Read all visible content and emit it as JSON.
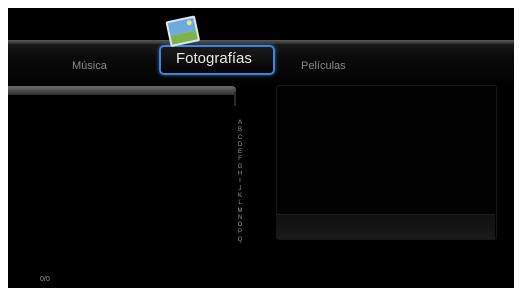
{
  "menu": {
    "items": [
      {
        "label": "Música"
      },
      {
        "label": "Fotografías"
      },
      {
        "label": "Películas"
      }
    ],
    "selected_index": 1,
    "selected_icon": "photo-icon"
  },
  "browser": {
    "counter": "0/0",
    "alphabet": [
      "A",
      "B",
      "C",
      "D",
      "E",
      "F",
      "G",
      "H",
      "I",
      "J",
      "K",
      "L",
      "M",
      "N",
      "O",
      "P",
      "Q"
    ]
  },
  "colors": {
    "background": "#000000",
    "selection_border": "#3f86d8",
    "inactive_text": "#8a8a8a",
    "active_text": "#e8e8e8"
  }
}
